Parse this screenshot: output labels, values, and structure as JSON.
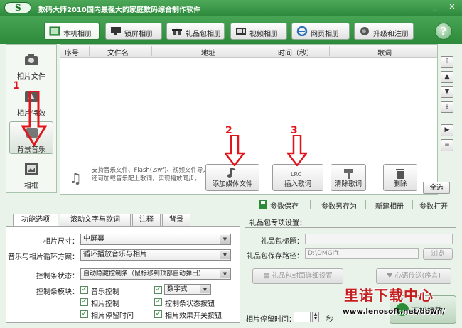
{
  "window": {
    "app_name": "数码大师2010",
    "subtitle": "国内最强大的家庭数码综合制作软件",
    "logo_text": "S"
  },
  "tabs": [
    {
      "label": "本机相册",
      "icon": "photo-album-icon"
    },
    {
      "label": "锁屏相册",
      "icon": "monitor-icon"
    },
    {
      "label": "礼品包相册",
      "icon": "gift-icon"
    },
    {
      "label": "视频相册",
      "icon": "film-icon"
    },
    {
      "label": "网页相册",
      "icon": "ie-icon"
    },
    {
      "label": "升级和注册",
      "icon": "globe-icon"
    }
  ],
  "help_label": "?",
  "sidenav": [
    {
      "label": "相片文件",
      "icon": "camera-icon"
    },
    {
      "label": "相片特效",
      "icon": "effects-icon"
    },
    {
      "label": "背景音乐",
      "icon": "music-icon"
    },
    {
      "label": "相框",
      "icon": "frame-icon"
    }
  ],
  "list": {
    "columns": [
      "序号",
      "文件名",
      "地址",
      "时间（秒）",
      "歌词"
    ],
    "hint": "支持音乐文件、Flash(.swf)、视频文件导入。还可加载音乐配上歌词，实现播放同步。"
  },
  "actions": [
    {
      "label": "添加媒体文件",
      "icon": "add-media-icon"
    },
    {
      "label": "插入歌词",
      "icon": "lrc-icon"
    },
    {
      "label": "清除歌词",
      "icon": "clear-icon"
    },
    {
      "label": "删除",
      "icon": "trash-icon"
    }
  ],
  "select_all_label": "全选",
  "param_links": [
    "参数保存",
    "参数另存为",
    "新建相册",
    "参数打开"
  ],
  "bottom_tabs": [
    "功能选项",
    "滚动文字与歌词",
    "注释",
    "背景"
  ],
  "options": {
    "photo_size_label": "相片尺寸：",
    "photo_size_value": "中屏幕",
    "loop_label": "音乐与相片循环方案：",
    "loop_value": "循环播放音乐与相片",
    "control_status_label": "控制条状态：",
    "control_status_value": "自动隐藏控制条（鼠标移到顶部自动弹出）",
    "control_modules_label": "控制条模块：",
    "modules": [
      {
        "label": "音乐控制",
        "checked": true
      },
      {
        "label": "数字式",
        "checked": true,
        "is_select": true
      },
      {
        "label": "相片控制",
        "checked": true
      },
      {
        "label": "控制条状态按钮",
        "checked": true
      },
      {
        "label": "相片停留时间",
        "checked": true
      },
      {
        "label": "相片效果开关按钮",
        "checked": true
      }
    ]
  },
  "gift": {
    "title": "礼品包专项设置：",
    "gift_title_label": "礼品包标题：",
    "gift_title_value": "",
    "save_path_label": "礼品包保存路径：",
    "save_path_value": "D:\\DMGift",
    "browse_label": "浏览",
    "cover_btn": "礼品包封面详细设置",
    "wish_btn": "心语传送(序言)"
  },
  "stay": {
    "label": "相片停留时间：",
    "unit": "秒"
  },
  "play_label": "开始播放",
  "annotations": [
    "1",
    "2",
    "3"
  ],
  "watermark": {
    "line1": "里诺下载中心",
    "line2": "www.lenosoft.net/down/"
  },
  "colors": {
    "accent_green": "#2e8a3c",
    "annotation_red": "#e0161c"
  }
}
